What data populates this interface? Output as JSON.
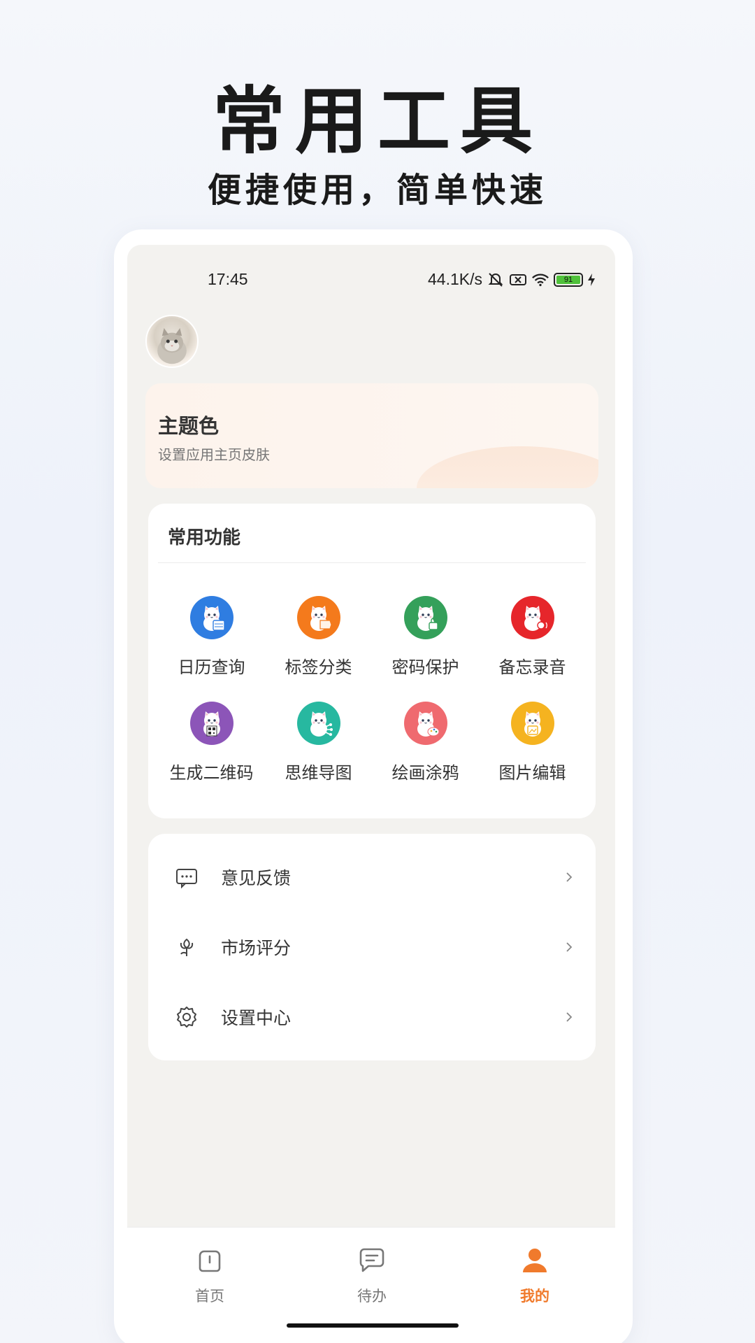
{
  "promo": {
    "title": "常用工具",
    "subtitle": "便捷使用，简单快速"
  },
  "status_bar": {
    "time": "17:45",
    "speed": "44.1K/s",
    "battery": "91"
  },
  "theme_card": {
    "title": "主题色",
    "description": "设置应用主页皮肤"
  },
  "functions": {
    "title": "常用功能",
    "items": [
      {
        "label": "日历查询",
        "color": "#2f7de1",
        "icon": "calendar-cat-icon"
      },
      {
        "label": "标签分类",
        "color": "#f47a1c",
        "icon": "tag-cat-icon"
      },
      {
        "label": "密码保护",
        "color": "#34a05a",
        "icon": "lock-cat-icon"
      },
      {
        "label": "备忘录音",
        "color": "#e6262b",
        "icon": "record-cat-icon"
      },
      {
        "label": "生成二维码",
        "color": "#8c55b8",
        "icon": "qrcode-cat-icon"
      },
      {
        "label": "思维导图",
        "color": "#27b8a0",
        "icon": "mindmap-cat-icon"
      },
      {
        "label": "绘画涂鸦",
        "color": "#ef6a6f",
        "icon": "paint-cat-icon"
      },
      {
        "label": "图片编辑",
        "color": "#f5b320",
        "icon": "image-cat-icon"
      }
    ]
  },
  "menu": {
    "items": [
      {
        "label": "意见反馈",
        "icon": "feedback-icon"
      },
      {
        "label": "市场评分",
        "icon": "flower-icon"
      },
      {
        "label": "设置中心",
        "icon": "gear-icon"
      }
    ]
  },
  "tabbar": {
    "items": [
      {
        "label": "首页",
        "icon": "home-icon",
        "active": false
      },
      {
        "label": "待办",
        "icon": "todo-icon",
        "active": false
      },
      {
        "label": "我的",
        "icon": "profile-icon",
        "active": true
      }
    ],
    "active_color": "#f07a2c"
  }
}
